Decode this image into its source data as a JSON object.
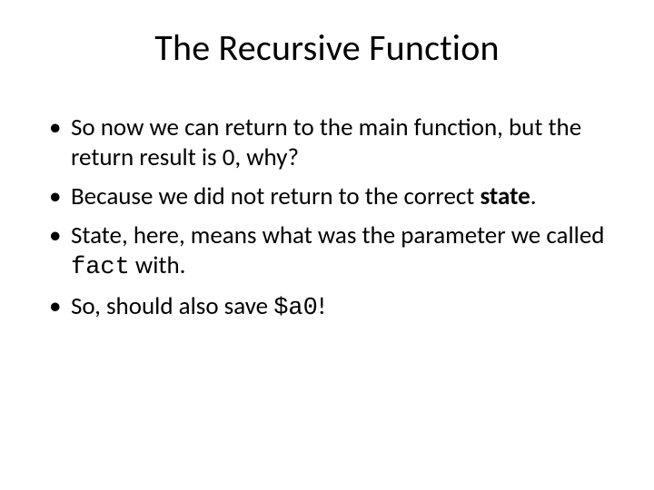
{
  "title": "The Recursive Function",
  "bullets": {
    "b1": "So now we can return to the main function, but the return result is 0, why?",
    "b2a": "Because we did not return to the correct ",
    "b2b": "state",
    "b2c": ".",
    "b3a": "State, here, means what was the parameter we called ",
    "b3b": "fact",
    "b3c": " with.",
    "b4a": "So, should also save ",
    "b4b": "$a0",
    "b4c": "!"
  }
}
